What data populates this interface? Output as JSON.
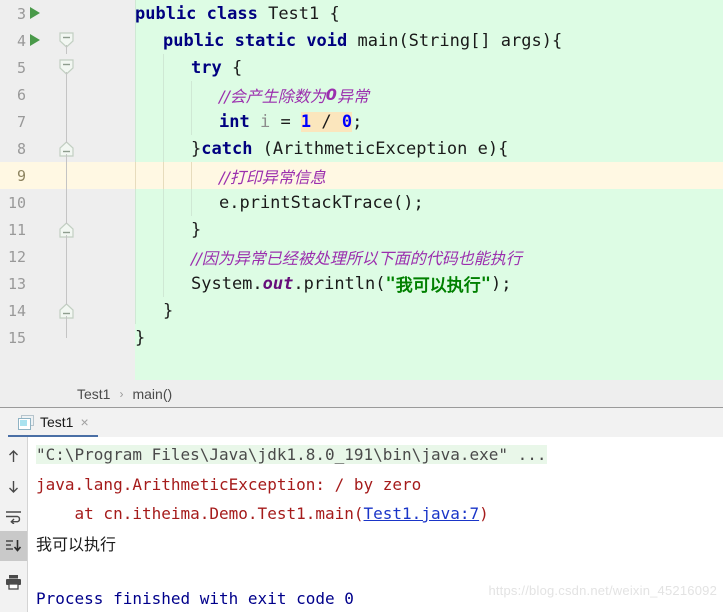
{
  "editor": {
    "background_color": "#ddfce4",
    "gutter_color": "#eeeeee",
    "current_line_color": "#fff8e3",
    "lines": [
      {
        "num": "3",
        "text": "public class Test1 {"
      },
      {
        "num": "4",
        "text": "    public static void main(String[] args){"
      },
      {
        "num": "5",
        "text": "        try {"
      },
      {
        "num": "6",
        "text": "            //会产生除数为0异常"
      },
      {
        "num": "7",
        "text": "            int i = 1 / 0;"
      },
      {
        "num": "8",
        "text": "        }catch (ArithmeticException e){"
      },
      {
        "num": "9",
        "text": "            //打印异常信息"
      },
      {
        "num": "10",
        "text": "            e.printStackTrace();"
      },
      {
        "num": "11",
        "text": "        }"
      },
      {
        "num": "12",
        "text": "        //因为异常已经被处理所以下面的代码也能执行"
      },
      {
        "num": "13",
        "text": "        System.out.println(\"我可以执行\");"
      },
      {
        "num": "14",
        "text": "    }"
      },
      {
        "num": "15",
        "text": "}"
      }
    ],
    "tokens": {
      "l3_public": "public ",
      "l3_class": "class ",
      "l3_name": "Test1 {",
      "l4_public": "public ",
      "l4_static": "static ",
      "l4_void": "void ",
      "l4_main": "main(String[] args){",
      "l5_try": "try",
      "l5_brace": " {",
      "l6_comment_a": "//会产生除数为",
      "l6_comment_b": "0",
      "l6_comment_c": "异常",
      "l7_int": "int ",
      "l7_var": "i",
      "l7_eq": " = ",
      "l7_one": "1",
      "l7_slash": " / ",
      "l7_zero": "0",
      "l7_semi": ";",
      "l8_close": "}",
      "l8_catch": "catch",
      "l8_rest": " (ArithmeticException e){",
      "l9_comment": "//打印异常信息",
      "l10_code": "e.printStackTrace();",
      "l11_code": "}",
      "l12_comment": "//因为异常已经被处理所以下面的代码也能执行",
      "l13_system": "System.",
      "l13_out": "out",
      "l13_println": ".println(",
      "l13_quote1": "\"",
      "l13_str": "我可以执行",
      "l13_quote2": "\"",
      "l13_tail": ");",
      "l14_code": "}",
      "l15_code": "}"
    }
  },
  "breadcrumb": {
    "class": "Test1",
    "separator": "›",
    "method": "main()"
  },
  "tabstrip": {
    "tabs": [
      {
        "label": "Test1",
        "icon": "run-configuration-icon",
        "close": "×"
      }
    ]
  },
  "console": {
    "toolbar": [
      {
        "name": "up-arrow-icon",
        "glyph": "↑",
        "active": false
      },
      {
        "name": "down-arrow-icon",
        "glyph": "↓",
        "active": false
      },
      {
        "name": "soft-wrap-icon",
        "glyph": "↩",
        "active": false
      },
      {
        "name": "scroll-to-end-icon",
        "glyph": "⤓",
        "active": true
      },
      {
        "name": "print-icon",
        "glyph": "⎙",
        "active": false
      }
    ],
    "lines": [
      {
        "kind": "command",
        "text": "\"C:\\Program Files\\Java\\jdk1.8.0_191\\bin\\java.exe\" ..."
      },
      {
        "kind": "error",
        "text": "java.lang.ArithmeticException: / by zero"
      },
      {
        "kind": "stacktrace",
        "prefix": "    at cn.itheima.Demo.Test1.main(",
        "link": "Test1.java:7",
        "suffix": ")"
      },
      {
        "kind": "output",
        "text": "我可以执行"
      },
      {
        "kind": "exit",
        "text": "Process finished with exit code 0"
      }
    ]
  },
  "watermark": {
    "text": "https://blog.csdn.net/weixin_45216092"
  }
}
